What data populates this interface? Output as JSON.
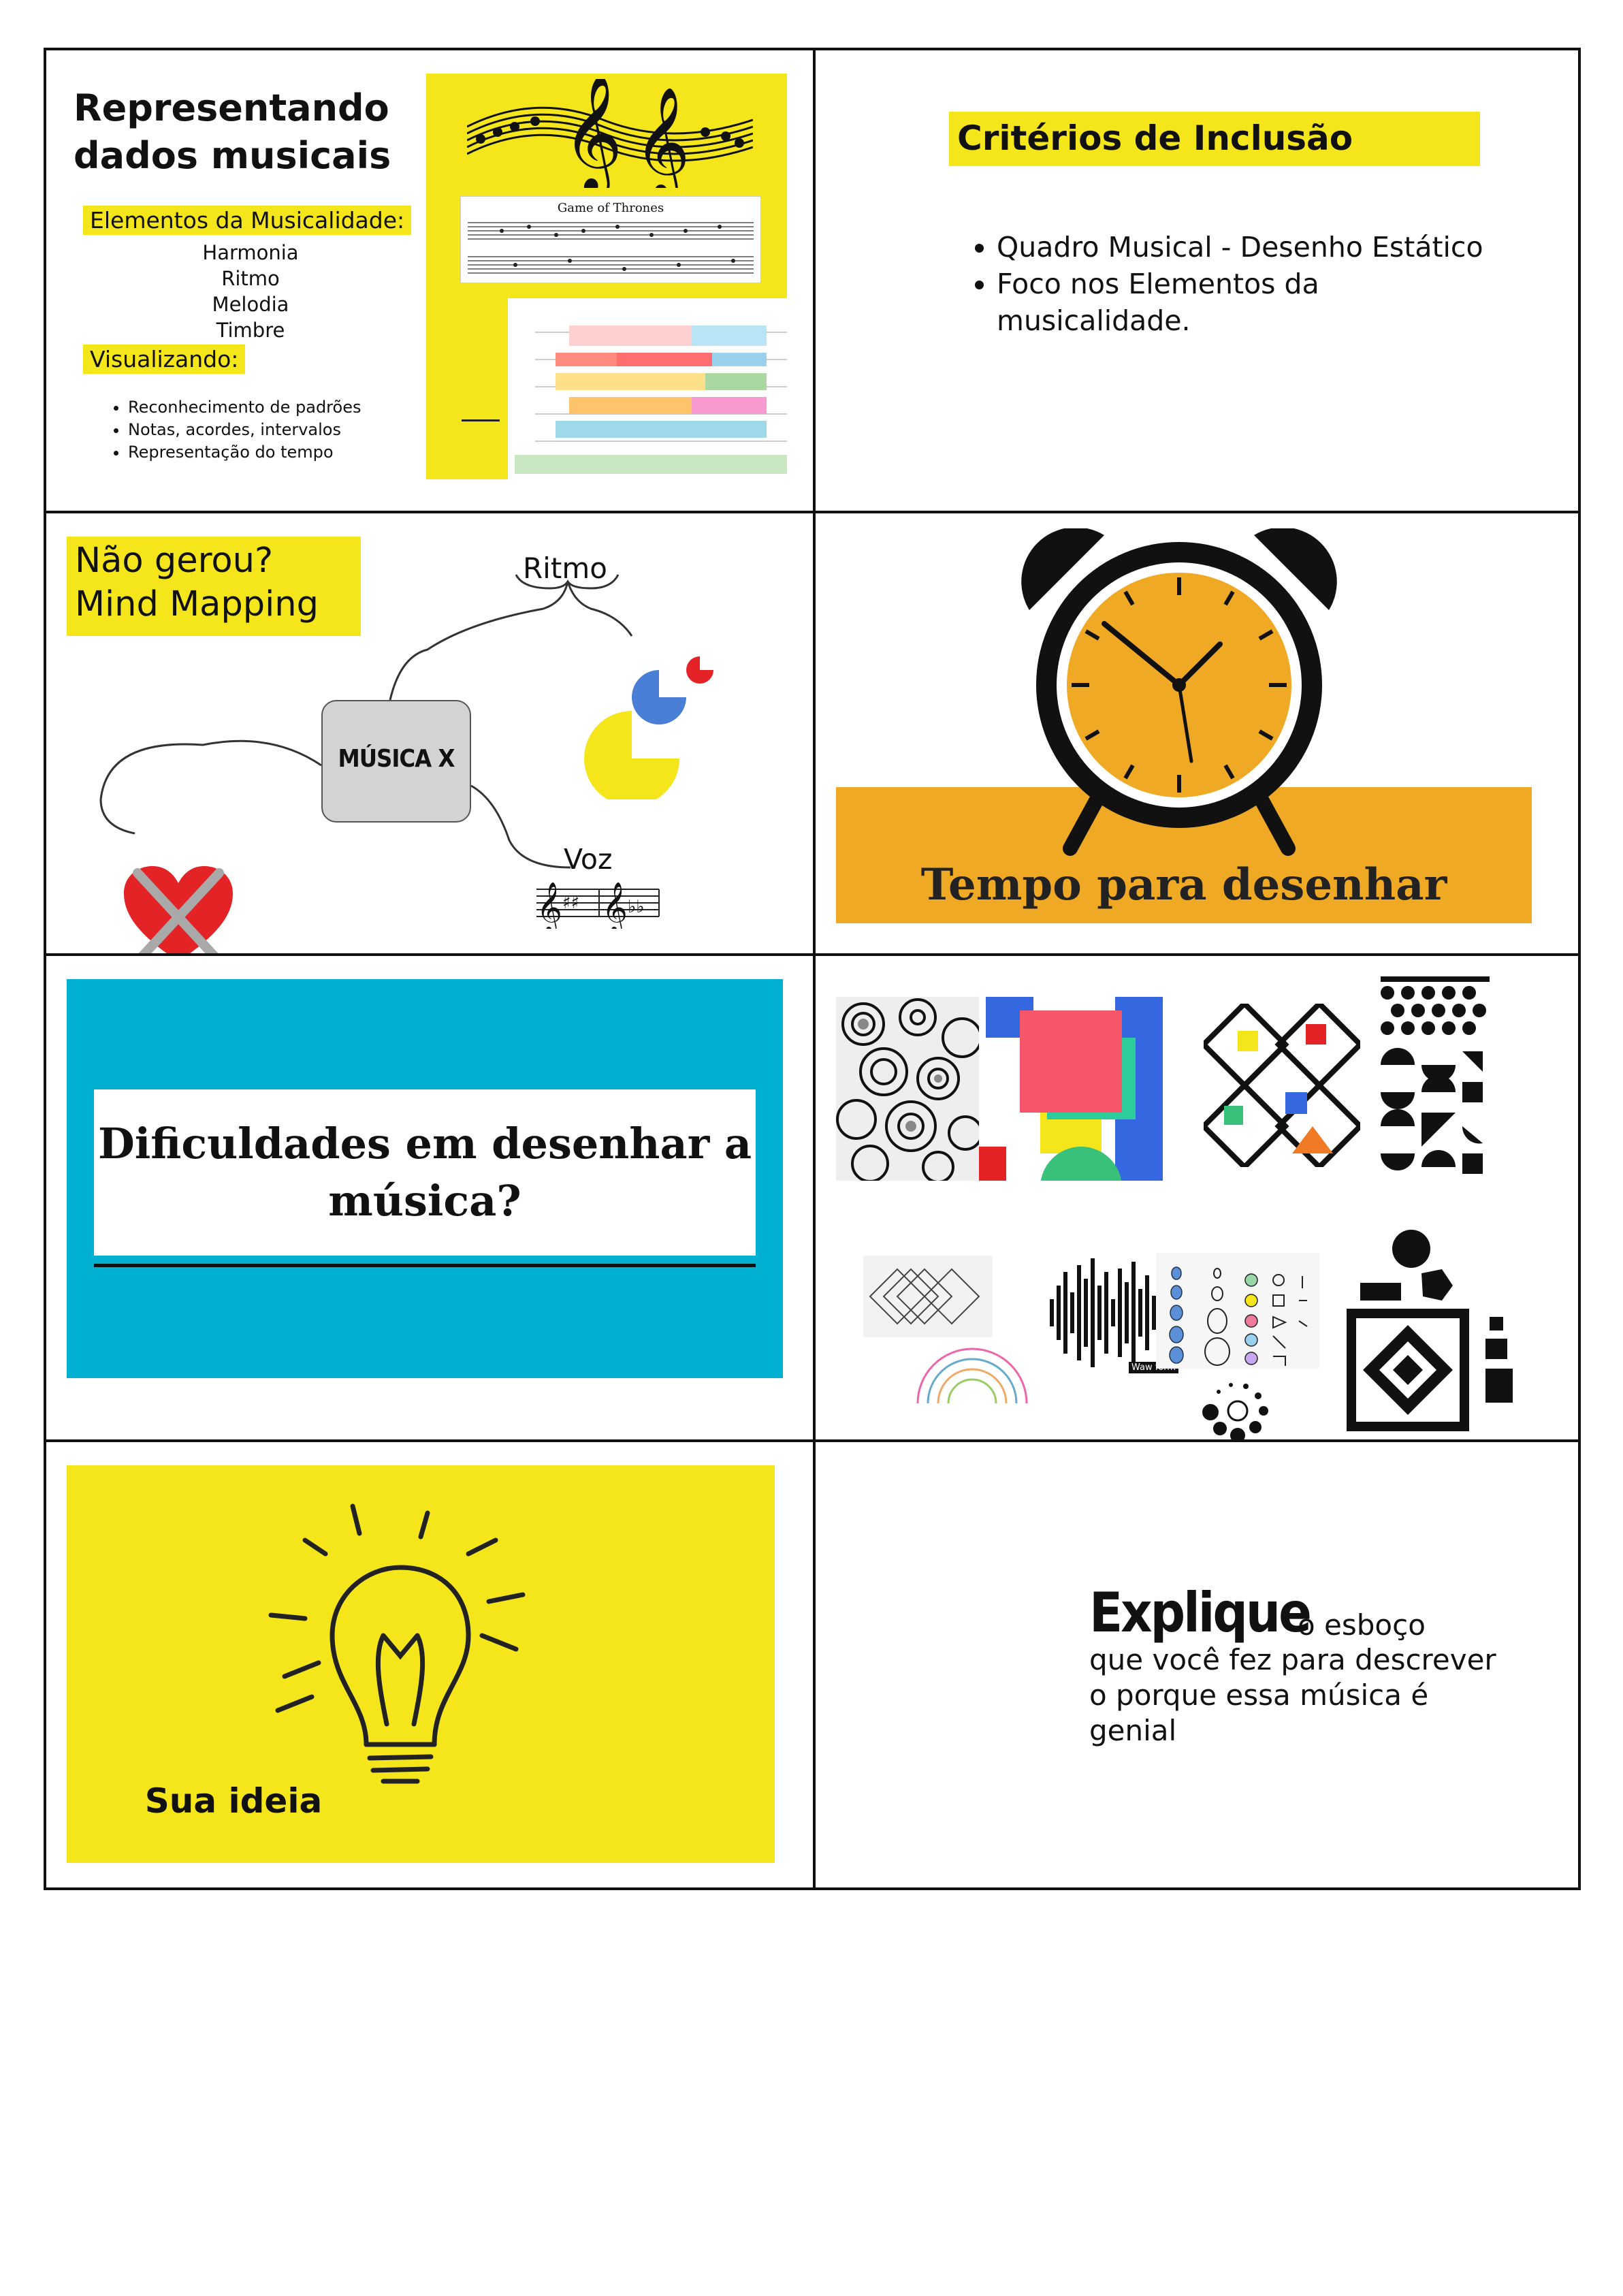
{
  "cell1": {
    "title_line1": "Representando",
    "title_line2": "dados musicais",
    "elements_heading": "Elementos da Musicalidade:",
    "elements": [
      "Harmonia",
      "Ritmo",
      "Melodia",
      "Timbre"
    ],
    "visualizing_heading": "Visualizando:",
    "bullets": [
      "Reconhecimento de padrões",
      "Notas, acordes, intervalos",
      "Representação do tempo"
    ],
    "score_title": "Game of Thrones"
  },
  "cell2": {
    "title": "Critérios de Inclusão",
    "bullets": [
      "Quadro Musical - Desenho Estático",
      "Foco nos Elementos da musicalidade."
    ]
  },
  "cell3": {
    "question_line1": "Não gerou?",
    "question_line2": "Mind Mapping",
    "center_node": "MÚSICA X",
    "branch_top": "Ritmo",
    "branch_bottom": "Voz"
  },
  "cell4": {
    "caption": "Tempo para desenhar"
  },
  "cell5": {
    "question_line1": "Dificuldades em desenhar a",
    "question_line2": "música?"
  },
  "cell6": {
    "waveform_label": "Waw form"
  },
  "cell7": {
    "caption": "Sua ideia"
  },
  "cell8": {
    "headline": "Explique",
    "headline_rest": "o esboço",
    "body": "que você fez para descrever o porque essa música é genial"
  },
  "colors": {
    "yellow": "#f5e61c",
    "orange": "#f0a925",
    "blue": "#00b0d0",
    "red": "#e42326",
    "pie_blue": "#4a7fd8"
  }
}
